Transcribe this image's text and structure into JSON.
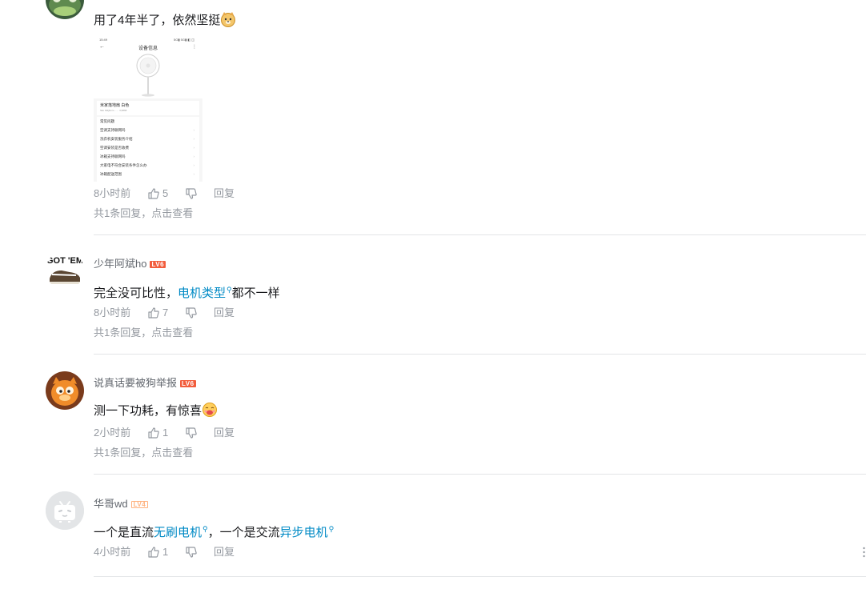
{
  "comments": [
    {
      "username": "",
      "level": "",
      "text": "用了4年半了，依然坚挺",
      "time": "8小时前",
      "likes": "5",
      "reply_label": "回复",
      "sub_replies": "共1条回复，点击查看",
      "image": {
        "status_time": "15:49",
        "status_right": "5G▮ 5G▮ ◧ ◫",
        "page_title": "设备信息",
        "device_name": "米家落地扇 白色",
        "device_sub": "Sku  bfdjfsnm……  3,6868",
        "section_title": "常见问题",
        "menu_items": [
          "空调支持联网吗",
          "洗衣机安装服务介绍",
          "空调安装是否收费",
          "冰箱支持联网吗",
          "大家电不符合安装条件怎么办",
          "冰箱配送范围"
        ]
      }
    },
    {
      "username": "少年阿斌ho",
      "level": "LV6",
      "text_before": "完全没可比性，",
      "link1": "电机类型",
      "text_after": "都不一样",
      "time": "8小时前",
      "likes": "7",
      "reply_label": "回复",
      "sub_replies": "共1条回复，点击查看",
      "avatar_text": "GOT 'EM"
    },
    {
      "username": "说真话要被狗举报",
      "level": "LV6",
      "text": "测一下功耗，有惊喜",
      "time": "2小时前",
      "likes": "1",
      "reply_label": "回复",
      "sub_replies": "共1条回复，点击查看"
    },
    {
      "username": "华哥wd",
      "level": "LV4",
      "text_a": "一个是直流",
      "link1": "无刷电机",
      "text_b": "，一个是交流",
      "link2": "异步电机",
      "time": "4小时前",
      "likes": "1",
      "reply_label": "回复"
    }
  ],
  "icons": {
    "like": "thumbs-up-icon",
    "dislike": "thumbs-down-icon",
    "search": "search-icon",
    "more": "more-vertical-icon"
  },
  "colors": {
    "link": "#008ac5",
    "meta": "#9499a0",
    "lv6": "#f25d3d",
    "lv4": "#ffb27f",
    "divider": "#e3e5e7"
  }
}
